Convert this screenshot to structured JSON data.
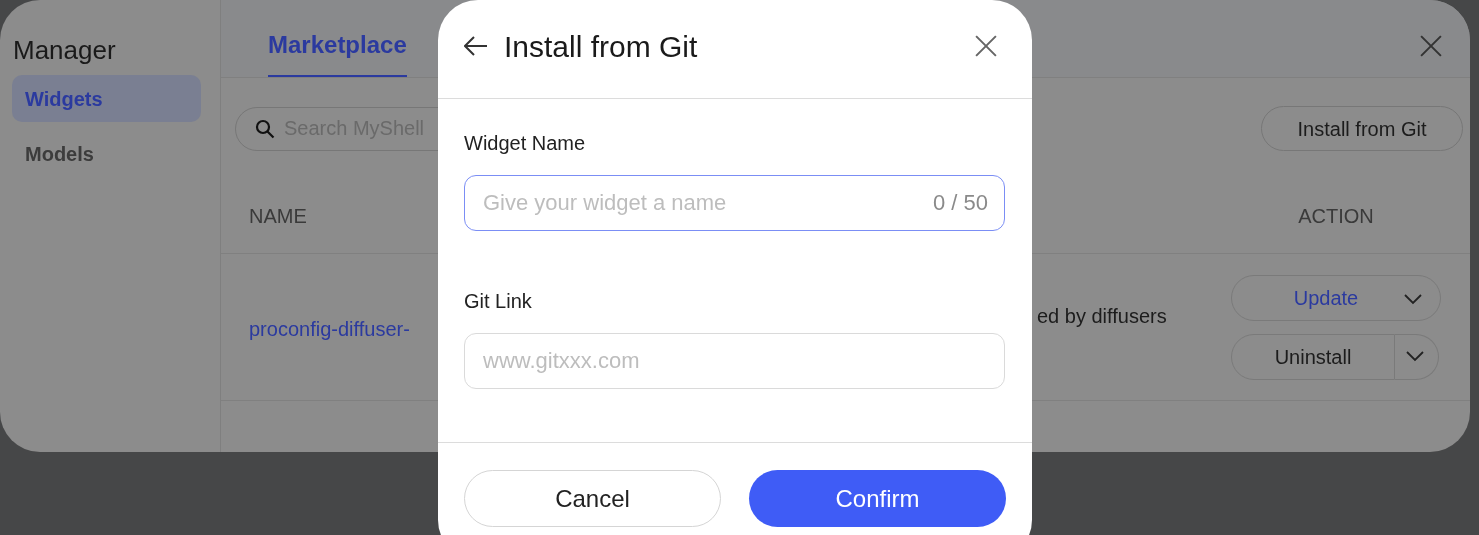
{
  "manager": {
    "title": "Manager",
    "sidebar": {
      "items": [
        {
          "label": "Widgets",
          "selected": true
        },
        {
          "label": "Models",
          "selected": false
        }
      ]
    },
    "tabs": [
      {
        "label": "Marketplace",
        "selected": true
      }
    ],
    "search": {
      "placeholder": "Search MyShell"
    },
    "install_button": "Install from Git",
    "table": {
      "columns": [
        "NAME",
        "ACTION"
      ],
      "rows": [
        {
          "name": "proconfig-diffuser-",
          "description": "ed by diffusers",
          "actions": [
            {
              "label": "Update",
              "kind": "link"
            },
            {
              "label": "Uninstall",
              "kind": "split"
            }
          ]
        }
      ]
    }
  },
  "dialog": {
    "title": "Install from Git",
    "fields": [
      {
        "label": "Widget Name",
        "placeholder": "Give your widget a name",
        "counter": "0 / 50",
        "focused": true
      },
      {
        "label": "Git Link",
        "placeholder": "www.gitxxx.com",
        "focused": false
      }
    ],
    "buttons": [
      {
        "label": "Cancel",
        "kind": "secondary"
      },
      {
        "label": "Confirm",
        "kind": "primary"
      }
    ]
  }
}
